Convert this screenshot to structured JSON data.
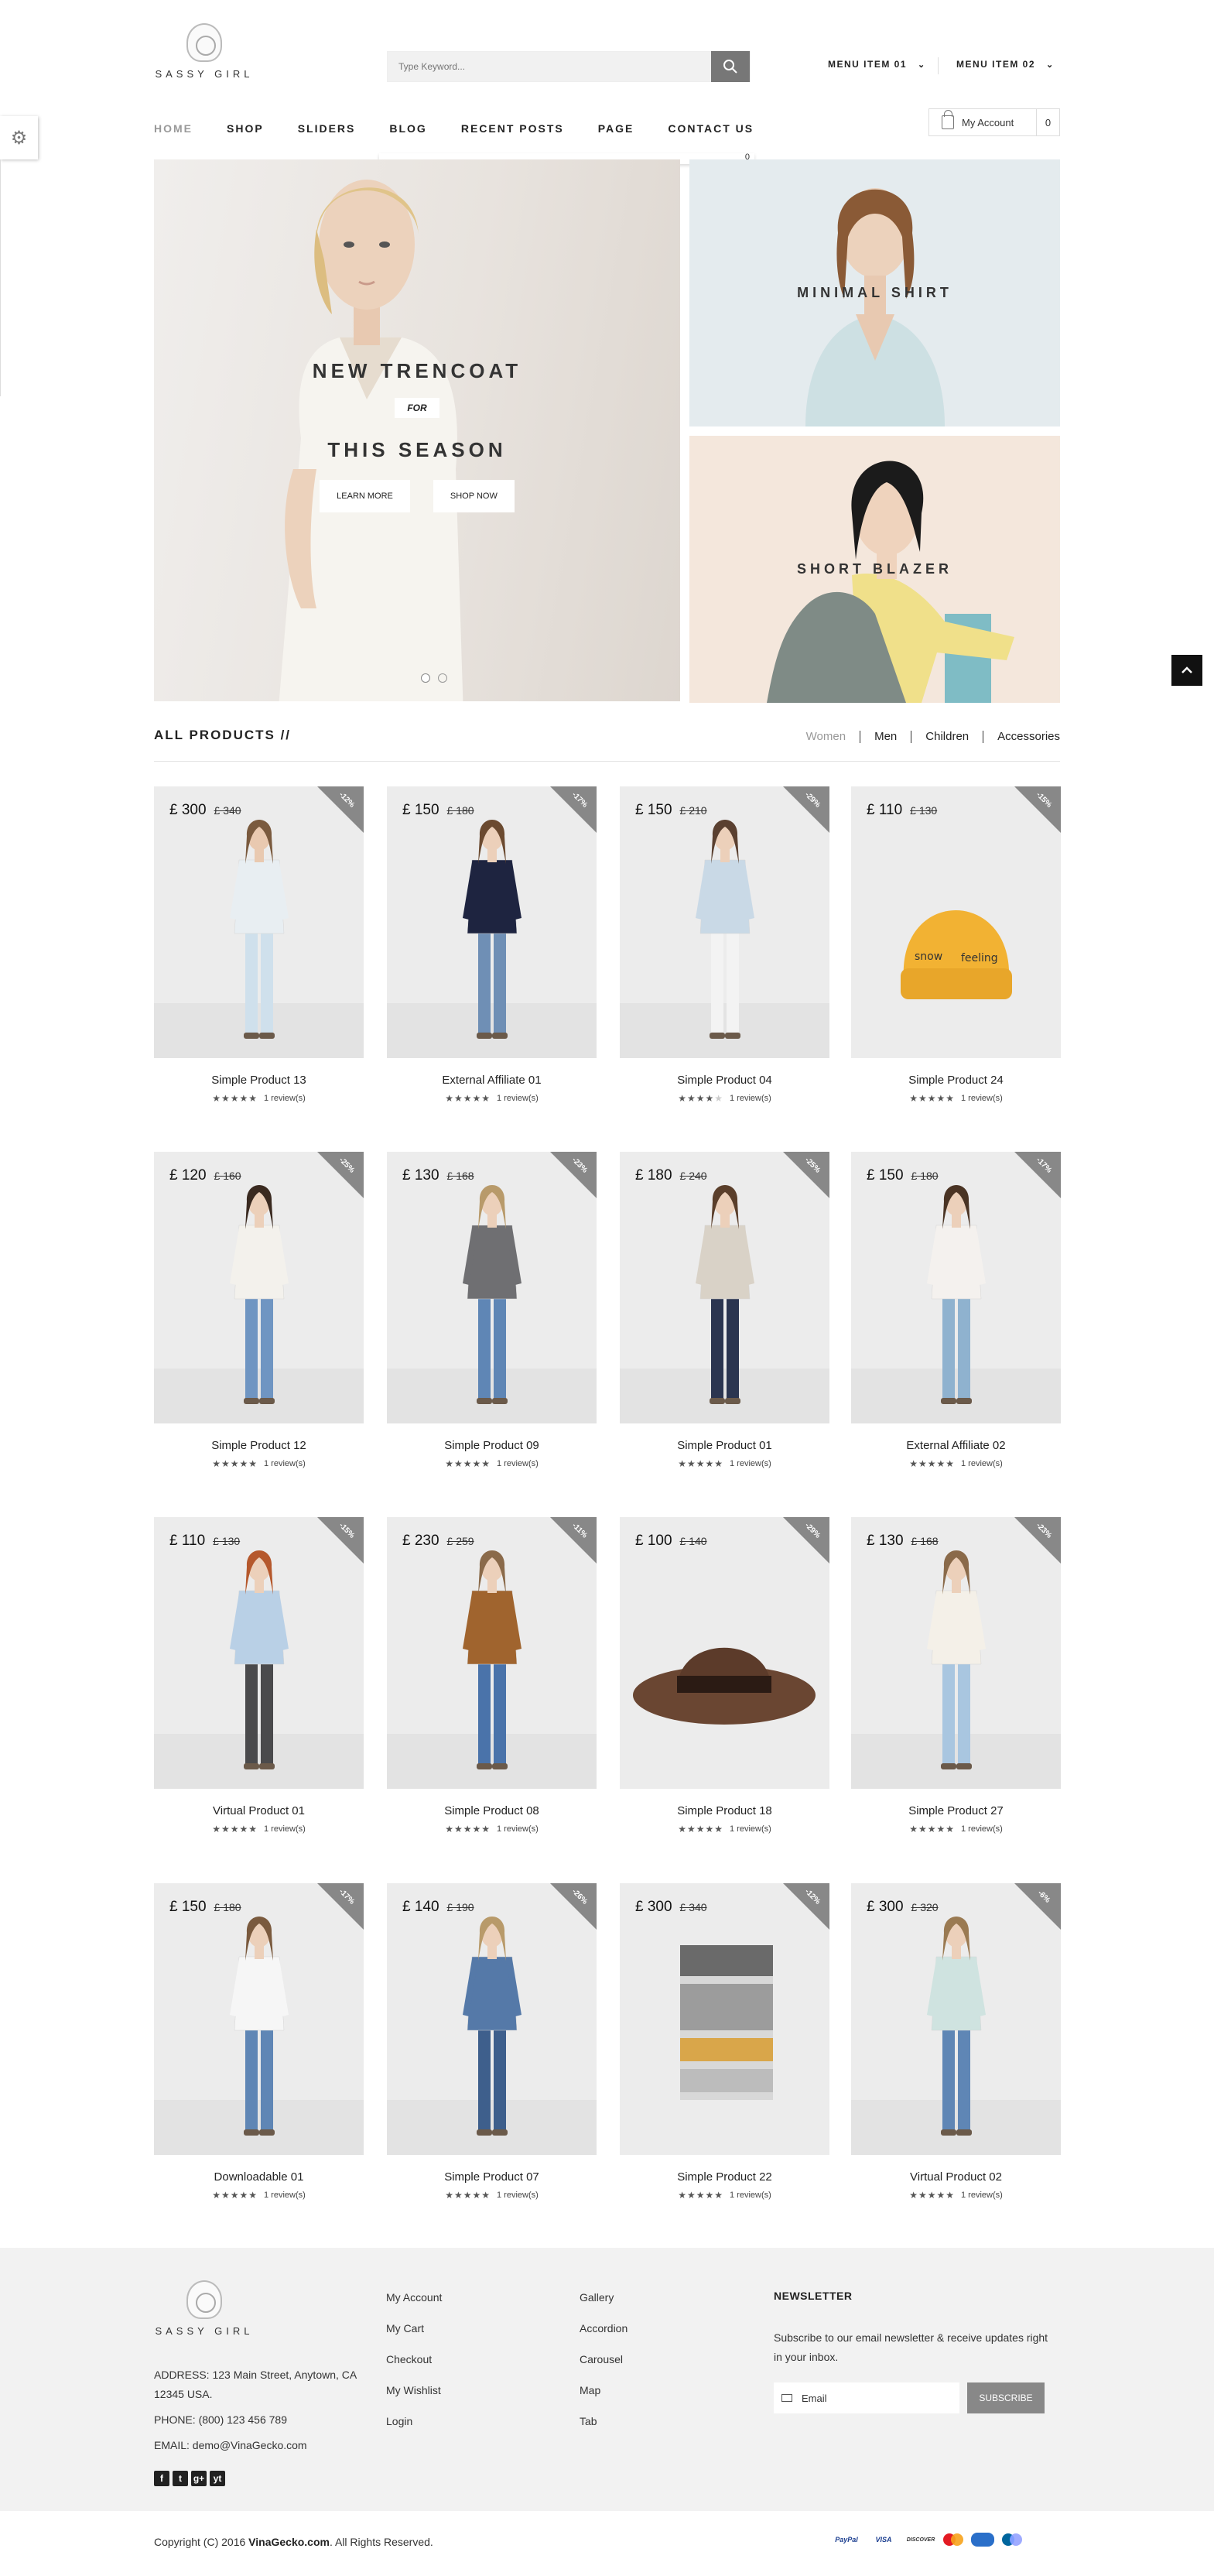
{
  "brand": {
    "name": "SASSY GIRL"
  },
  "header": {
    "search_placeholder": "Type Keyword...",
    "menu_item_1": "MENU ITEM 01",
    "menu_item_2": "MENU ITEM 02",
    "nav": [
      "HOME",
      "SHOP",
      "SLIDERS",
      "BLOG",
      "RECENT POSTS",
      "PAGE",
      "CONTACT US"
    ],
    "account_label": "My Account",
    "cart_count": "0",
    "cart_dropdown_count": "0"
  },
  "hero": {
    "line1": "NEW TRENCOAT",
    "for": "FOR",
    "line2": "THIS SEASON",
    "btn_learn": "LEARN MORE",
    "btn_shop": "SHOP NOW",
    "banner1": "MINIMAL SHIRT",
    "banner2": "SHORT BLAZER"
  },
  "products_section": {
    "title": "ALL PRODUCTS //",
    "tabs": [
      "Women",
      "Men",
      "Children",
      "Accessories"
    ]
  },
  "products": [
    {
      "name": "Simple Product 13",
      "price": "£ 300",
      "old": "£ 340",
      "disc": "-12%",
      "rating": 5,
      "reviews": "1 review(s)",
      "kind": "woman",
      "top": "#e8eef2",
      "bottom": "#cfe0ec",
      "skin": "#e9c9b0",
      "hair": "#7a5a3e"
    },
    {
      "name": "External Affiliate 01",
      "price": "£ 150",
      "old": "£ 180",
      "disc": "-17%",
      "rating": 5,
      "reviews": "1 review(s)",
      "kind": "woman",
      "top": "#1e2440",
      "bottom": "#6f8fb5",
      "skin": "#ecd0ba",
      "hair": "#6b4a30"
    },
    {
      "name": "Simple Product 04",
      "price": "£ 150",
      "old": "£ 210",
      "disc": "-29%",
      "rating": 4,
      "reviews": "1 review(s)",
      "kind": "woman",
      "top": "#c9d9e6",
      "bottom": "#f3f3f3",
      "skin": "#ecd0ba",
      "hair": "#5a4030"
    },
    {
      "name": "Simple Product 24",
      "price": "£ 110",
      "old": "£ 130",
      "disc": "-15%",
      "rating": 5,
      "reviews": "1 review(s)",
      "kind": "beanie",
      "top": "#f2b233",
      "bottom": "#f2b233",
      "skin": "#000",
      "hair": "#000"
    },
    {
      "name": "Simple Product 12",
      "price": "£ 120",
      "old": "£ 160",
      "disc": "-25%",
      "rating": 5,
      "reviews": "1 review(s)",
      "kind": "woman",
      "top": "#f3f1ec",
      "bottom": "#6f95c2",
      "skin": "#ecd0ba",
      "hair": "#3a2a20"
    },
    {
      "name": "Simple Product 09",
      "price": "£ 130",
      "old": "£ 168",
      "disc": "-23%",
      "rating": 5,
      "reviews": "1 review(s)",
      "kind": "woman",
      "top": "#6f6f72",
      "bottom": "#5f86b5",
      "skin": "#ecd0ba",
      "hair": "#b89a6a"
    },
    {
      "name": "Simple Product 01",
      "price": "£ 180",
      "old": "£ 240",
      "disc": "-25%",
      "rating": 5,
      "reviews": "1 review(s)",
      "kind": "woman",
      "top": "#d9d2c7",
      "bottom": "#2b3550",
      "skin": "#ecd0ba",
      "hair": "#5a3e2a"
    },
    {
      "name": "External Affiliate 02",
      "price": "£ 150",
      "old": "£ 180",
      "disc": "-17%",
      "rating": 5,
      "reviews": "1 review(s)",
      "kind": "woman",
      "top": "#f4f1ee",
      "bottom": "#8fb2cf",
      "skin": "#ecd0ba",
      "hair": "#4a3424"
    },
    {
      "name": "Virtual Product 01",
      "price": "£ 110",
      "old": "£ 130",
      "disc": "-15%",
      "rating": 5,
      "reviews": "1 review(s)",
      "kind": "woman",
      "top": "#b9d0e6",
      "bottom": "#4a4a4c",
      "skin": "#ecd0ba",
      "hair": "#b5582c"
    },
    {
      "name": "Simple Product 08",
      "price": "£ 230",
      "old": "£ 259",
      "disc": "-11%",
      "rating": 5,
      "reviews": "1 review(s)",
      "kind": "woman",
      "top": "#a0642e",
      "bottom": "#4a73aa",
      "skin": "#ecd0ba",
      "hair": "#8a6a4a"
    },
    {
      "name": "Simple Product 18",
      "price": "£ 100",
      "old": "£ 140",
      "disc": "-29%",
      "rating": 5,
      "reviews": "1 review(s)",
      "kind": "hat",
      "top": "#5c3b2a",
      "bottom": "#5c3b2a",
      "skin": "#000",
      "hair": "#000"
    },
    {
      "name": "Simple Product 27",
      "price": "£ 130",
      "old": "£ 168",
      "disc": "-23%",
      "rating": 5,
      "reviews": "1 review(s)",
      "kind": "woman",
      "top": "#f4f0e8",
      "bottom": "#a9c6e0",
      "skin": "#ecd0ba",
      "hair": "#8a6a4a"
    },
    {
      "name": "Downloadable 01",
      "price": "£ 150",
      "old": "£ 180",
      "disc": "-17%",
      "rating": 5,
      "reviews": "1 review(s)",
      "kind": "woman",
      "top": "#f6f6f6",
      "bottom": "#5f86b5",
      "skin": "#ecd0ba",
      "hair": "#7a5a3e"
    },
    {
      "name": "Simple Product 07",
      "price": "£ 140",
      "old": "£ 190",
      "disc": "-26%",
      "rating": 5,
      "reviews": "1 review(s)",
      "kind": "woman",
      "top": "#5579a8",
      "bottom": "#3e5f8c",
      "skin": "#ecd0ba",
      "hair": "#b89a6a"
    },
    {
      "name": "Simple Product 22",
      "price": "£ 300",
      "old": "£ 340",
      "disc": "-12%",
      "rating": 5,
      "reviews": "1 review(s)",
      "kind": "scarf",
      "top": "#6a6a6a",
      "bottom": "#d9a64a",
      "skin": "#000",
      "hair": "#000"
    },
    {
      "name": "Virtual Product 02",
      "price": "£ 300",
      "old": "£ 320",
      "disc": "-6%",
      "rating": 5,
      "reviews": "1 review(s)",
      "kind": "woman",
      "top": "#cfe3e0",
      "bottom": "#5f86b5",
      "skin": "#ecd0ba",
      "hair": "#9a7a52"
    }
  ],
  "footer": {
    "address": "ADDRESS: 123 Main Street, Anytown, CA 12345 USA.",
    "phone": "PHONE: (800) 123 456 789",
    "email": "EMAIL: demo@VinaGecko.com",
    "social": [
      "f",
      "t",
      "g+",
      "yt"
    ],
    "col1": [
      "My Account",
      "My Cart",
      "Checkout",
      "My Wishlist",
      "Login"
    ],
    "col2": [
      "Gallery",
      "Accordion",
      "Carousel",
      "Map",
      "Tab"
    ],
    "newsletter_title": "NEWSLETTER",
    "newsletter_text": "Subscribe to our email newsletter & receive updates right in your inbox.",
    "email_placeholder": "Email",
    "subscribe": "SUBSCRIBE",
    "copyright_pre": "Copyright (C) 2016 ",
    "copyright_brand": "VinaGecko.com",
    "copyright_post": ". All Rights Reserved.",
    "payments": [
      "PayPal",
      "VISA",
      "DISCOVER"
    ]
  },
  "colors": {
    "accent": "#888888",
    "footer_bg": "#f2f2f2",
    "text": "#222222"
  }
}
